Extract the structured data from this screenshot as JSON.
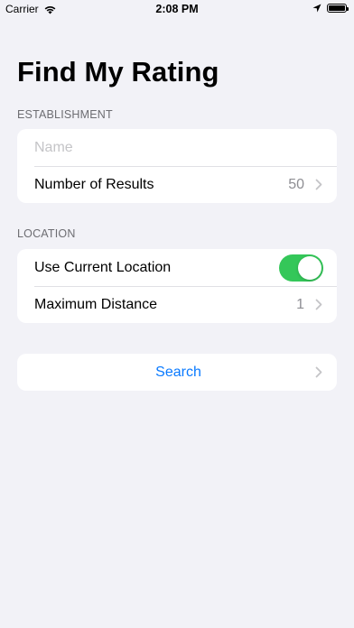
{
  "status_bar": {
    "carrier": "Carrier",
    "time": "2:08 PM",
    "battery_level": 1.0
  },
  "page": {
    "title": "Find My Rating"
  },
  "establishment": {
    "header": "ESTABLISHMENT",
    "name_placeholder": "Name",
    "name_value": "",
    "results_label": "Number of Results",
    "results_value": "50"
  },
  "location": {
    "header": "LOCATION",
    "use_current_label": "Use Current Location",
    "use_current_on": true,
    "distance_label": "Maximum Distance",
    "distance_value": "1"
  },
  "search": {
    "label": "Search"
  },
  "colors": {
    "background": "#f2f2f7",
    "accent": "#0a7aff",
    "toggle_on": "#34c759",
    "secondary_text": "#8e8e93"
  }
}
